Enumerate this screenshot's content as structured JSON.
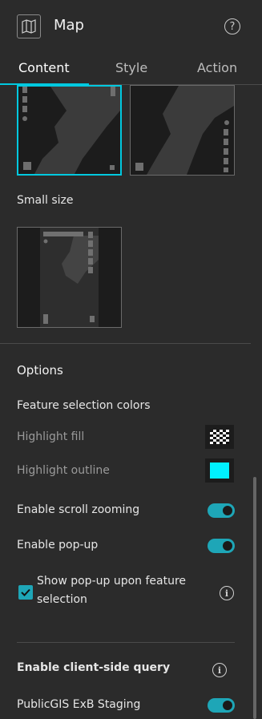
{
  "header": {
    "title": "Map",
    "map_icon": "map-icon",
    "help_icon": "help-icon"
  },
  "tabs": [
    {
      "label": "Content",
      "active": true
    },
    {
      "label": "Style",
      "active": false
    },
    {
      "label": "Action",
      "active": false
    }
  ],
  "layouts": {
    "small_size_label": "Small size"
  },
  "options": {
    "section_title": "Options",
    "feature_colors_label": "Feature selection colors",
    "highlight_fill_label": "Highlight fill",
    "highlight_outline_label": "Highlight outline",
    "outline_color": "#00f0ff",
    "scroll_zoom_label": "Enable scroll zooming",
    "scroll_zoom_on": true,
    "popup_label": "Enable pop-up",
    "popup_on": true,
    "show_popup_label_line1": "Show pop-up upon feature",
    "show_popup_label_line2": "selection",
    "show_popup_checked": true
  },
  "client_query": {
    "title": "Enable client-side query",
    "source_label": "PublicGIS ExB Staging",
    "source_on": true
  },
  "colors": {
    "accent": "#00c9e0",
    "toggle": "#1ea6b7",
    "panel": "#2b2b2b"
  }
}
